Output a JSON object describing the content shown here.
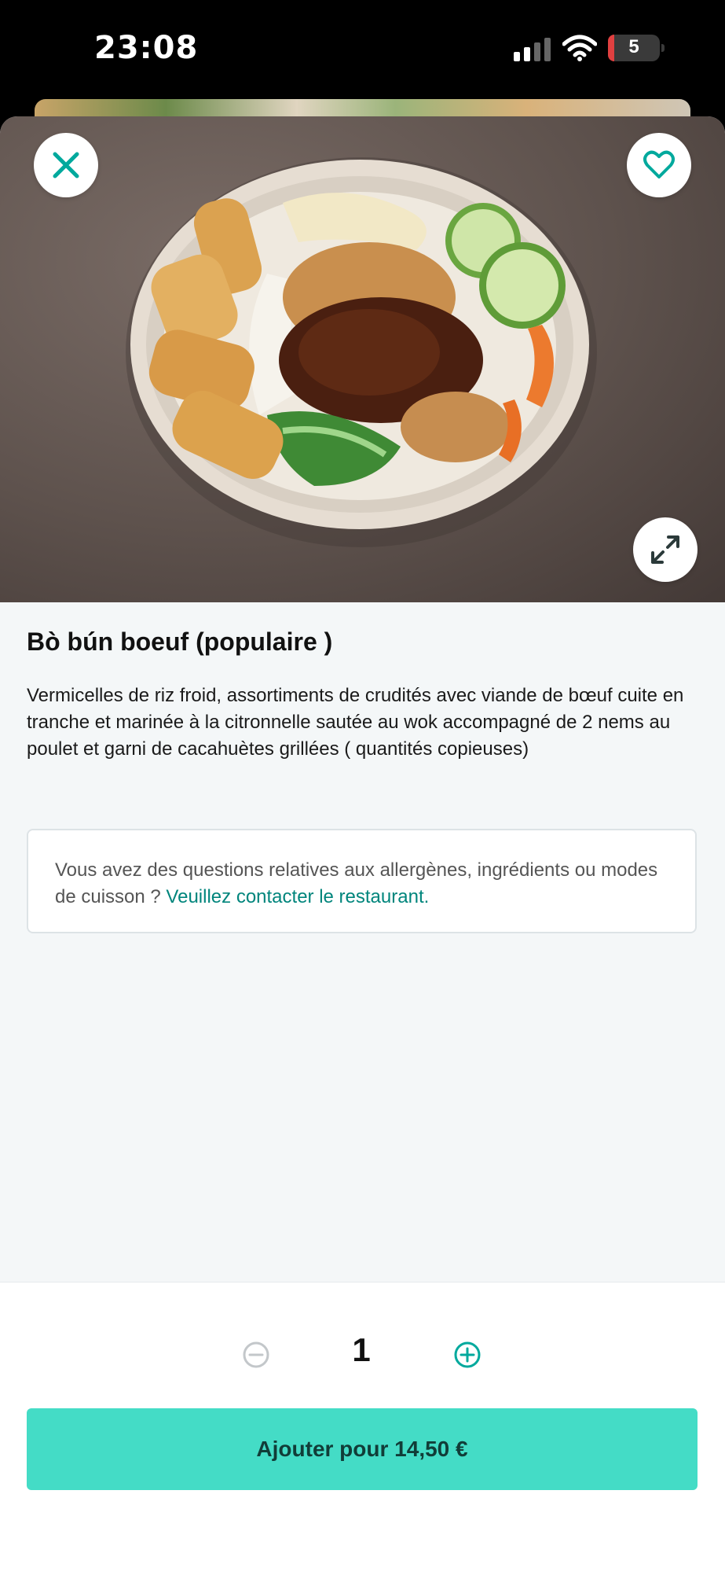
{
  "status_bar": {
    "time": "23:08",
    "battery_level": "5"
  },
  "dish": {
    "title": "Bò bún boeuf (populaire )",
    "description": "Vermicelles de riz froid, assortiments de crudités avec viande de bœuf cuite en tranche et marinée à la citronnelle sautée au wok  accompagné de 2 nems au poulet et garni de cacahuètes grillées ( quantités copieuses)"
  },
  "allergen_notice": {
    "text": "Vous avez des questions relatives aux allergènes, ingrédients ou modes de cuisson ? ",
    "link": "Veuillez contacter le restaurant."
  },
  "order": {
    "quantity": "1",
    "add_button_label": "Ajouter pour 14,50 €"
  },
  "icons": {
    "close": "close-icon",
    "favorite": "heart-icon",
    "expand": "expand-icon",
    "minus": "minus-circle-icon",
    "plus": "plus-circle-icon"
  },
  "colors": {
    "accent": "#00a99d",
    "button": "#44dcc6",
    "button_text": "#113d38",
    "link": "#00857c"
  }
}
